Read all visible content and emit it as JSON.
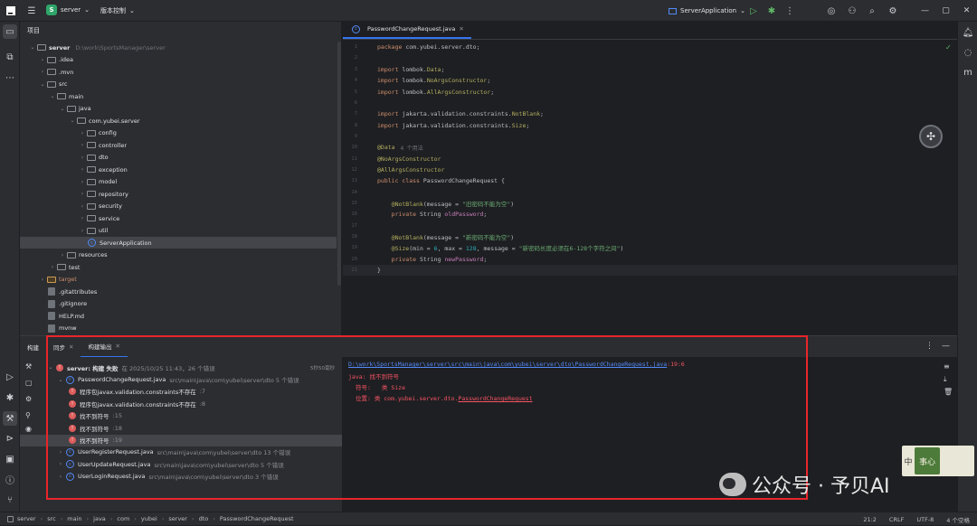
{
  "titlebar": {
    "project_badge": "S",
    "project": "server",
    "vcs": "版本控制",
    "run_config": "ServerApplication"
  },
  "project_panel": {
    "title": "项目",
    "tree": [
      {
        "label": "server",
        "hint": "D:\\work\\SportsManager\\server",
        "depth": 0,
        "kind": "module",
        "open": true
      },
      {
        "label": ".idea",
        "depth": 1,
        "kind": "folder"
      },
      {
        "label": ".mvn",
        "depth": 1,
        "kind": "folder"
      },
      {
        "label": "src",
        "depth": 1,
        "kind": "folder",
        "open": true
      },
      {
        "label": "main",
        "depth": 2,
        "kind": "folder",
        "open": true
      },
      {
        "label": "java",
        "depth": 3,
        "kind": "src",
        "open": true
      },
      {
        "label": "com.yubei.server",
        "depth": 4,
        "kind": "pkg",
        "open": true
      },
      {
        "label": "config",
        "depth": 5,
        "kind": "pkg"
      },
      {
        "label": "controller",
        "depth": 5,
        "kind": "pkg"
      },
      {
        "label": "dto",
        "depth": 5,
        "kind": "pkg"
      },
      {
        "label": "exception",
        "depth": 5,
        "kind": "pkg"
      },
      {
        "label": "model",
        "depth": 5,
        "kind": "pkg"
      },
      {
        "label": "repository",
        "depth": 5,
        "kind": "pkg"
      },
      {
        "label": "security",
        "depth": 5,
        "kind": "pkg"
      },
      {
        "label": "service",
        "depth": 5,
        "kind": "pkg"
      },
      {
        "label": "util",
        "depth": 5,
        "kind": "pkg"
      },
      {
        "label": "ServerApplication",
        "depth": 5,
        "kind": "class",
        "selected": true
      },
      {
        "label": "resources",
        "depth": 3,
        "kind": "folder"
      },
      {
        "label": "test",
        "depth": 2,
        "kind": "folder"
      },
      {
        "label": "target",
        "depth": 1,
        "kind": "target"
      },
      {
        "label": ".gitattributes",
        "depth": 1,
        "kind": "file"
      },
      {
        "label": ".gitignore",
        "depth": 1,
        "kind": "file"
      },
      {
        "label": "HELP.md",
        "depth": 1,
        "kind": "file"
      },
      {
        "label": "mvnw",
        "depth": 1,
        "kind": "file"
      }
    ]
  },
  "editor": {
    "tab": "PasswordChangeRequest.java",
    "lines": [
      {
        "n": "1",
        "tokens": [
          [
            "kw",
            "package "
          ],
          [
            "cls",
            "com.yubei.server.dto;"
          ]
        ]
      },
      {
        "n": "2",
        "tokens": []
      },
      {
        "n": "3",
        "tokens": [
          [
            "kw",
            "import "
          ],
          [
            "cls",
            "lombok."
          ],
          [
            "ann",
            "Data"
          ],
          [
            "cls",
            ";"
          ]
        ]
      },
      {
        "n": "4",
        "tokens": [
          [
            "kw",
            "import "
          ],
          [
            "cls",
            "lombok."
          ],
          [
            "ann",
            "NoArgsConstructor"
          ],
          [
            "cls",
            ";"
          ]
        ]
      },
      {
        "n": "5",
        "tokens": [
          [
            "kw",
            "import "
          ],
          [
            "cls",
            "lombok."
          ],
          [
            "ann",
            "AllArgsConstructor"
          ],
          [
            "cls",
            ";"
          ]
        ]
      },
      {
        "n": "6",
        "tokens": []
      },
      {
        "n": "7",
        "tokens": [
          [
            "kw",
            "import "
          ],
          [
            "cls",
            "jakarta.validation.constraints."
          ],
          [
            "ann",
            "NotBlank"
          ],
          [
            "cls",
            ";"
          ]
        ]
      },
      {
        "n": "8",
        "tokens": [
          [
            "kw",
            "import "
          ],
          [
            "cls",
            "jakarta.validation.constraints."
          ],
          [
            "ann",
            "Size"
          ],
          [
            "cls",
            ";"
          ]
        ]
      },
      {
        "n": "9",
        "tokens": []
      },
      {
        "n": "10",
        "tokens": [
          [
            "ann",
            "@Data"
          ]
        ],
        "hint": "4 个用法"
      },
      {
        "n": "11",
        "tokens": [
          [
            "ann",
            "@NoArgsConstructor"
          ]
        ]
      },
      {
        "n": "12",
        "tokens": [
          [
            "ann",
            "@AllArgsConstructor"
          ]
        ]
      },
      {
        "n": "13",
        "tokens": [
          [
            "kw",
            "public class "
          ],
          [
            "cls",
            "PasswordChangeRequest {"
          ]
        ]
      },
      {
        "n": "14",
        "tokens": []
      },
      {
        "n": "15",
        "tokens": [
          [
            "cls",
            "    "
          ],
          [
            "ann",
            "@NotBlank"
          ],
          [
            "cls",
            "(message = "
          ],
          [
            "str",
            "\"旧密码不能为空\""
          ],
          [
            "cls",
            ")"
          ]
        ]
      },
      {
        "n": "16",
        "tokens": [
          [
            "cls",
            "    "
          ],
          [
            "kw",
            "private "
          ],
          [
            "cls",
            "String "
          ],
          [
            "fld",
            "oldPassword"
          ],
          [
            "cls",
            ";"
          ]
        ]
      },
      {
        "n": "17",
        "tokens": []
      },
      {
        "n": "18",
        "tokens": [
          [
            "cls",
            "    "
          ],
          [
            "ann",
            "@NotBlank"
          ],
          [
            "cls",
            "(message = "
          ],
          [
            "str",
            "\"新密码不能为空\""
          ],
          [
            "cls",
            ")"
          ]
        ]
      },
      {
        "n": "19",
        "tokens": [
          [
            "cls",
            "    "
          ],
          [
            "ann",
            "@Size"
          ],
          [
            "cls",
            "(min = "
          ],
          [
            "num",
            "6"
          ],
          [
            "cls",
            ", max = "
          ],
          [
            "num",
            "128"
          ],
          [
            "cls",
            ", message = "
          ],
          [
            "str",
            "\"新密码长度必须在6-128个字符之间\""
          ],
          [
            "cls",
            ")"
          ]
        ]
      },
      {
        "n": "20",
        "tokens": [
          [
            "cls",
            "    "
          ],
          [
            "kw",
            "private "
          ],
          [
            "cls",
            "String "
          ],
          [
            "fld",
            "newPassword"
          ],
          [
            "cls",
            ";"
          ]
        ]
      },
      {
        "n": "21",
        "tokens": [
          [
            "cls",
            "}"
          ]
        ],
        "current": true
      }
    ]
  },
  "build_panel": {
    "title": "构建",
    "tabs": [
      "同步",
      "构建输出"
    ],
    "summary": "server: 构建 失败",
    "summary_time": "在 2025/10/25 11:43，26 个错误",
    "duration": "5秒50毫秒",
    "tree": [
      {
        "label": "PasswordChangeRequest.java",
        "hint": "src\\main\\java\\com\\yubei\\server\\dto 5 个错误",
        "depth": 1,
        "kind": "file",
        "open": true
      },
      {
        "label": "程序包javax.validation.constraints不存在",
        "hint": ":7",
        "depth": 2,
        "kind": "err"
      },
      {
        "label": "程序包javax.validation.constraints不存在",
        "hint": ":8",
        "depth": 2,
        "kind": "err"
      },
      {
        "label": "找不到符号",
        "hint": ":15",
        "depth": 2,
        "kind": "err"
      },
      {
        "label": "找不到符号",
        "hint": ":18",
        "depth": 2,
        "kind": "err"
      },
      {
        "label": "找不到符号",
        "hint": ":19",
        "depth": 2,
        "kind": "err",
        "selected": true
      },
      {
        "label": "UserRegisterRequest.java",
        "hint": "src\\main\\java\\com\\yubei\\server\\dto 13 个错误",
        "depth": 1,
        "kind": "file"
      },
      {
        "label": "UserUpdateRequest.java",
        "hint": "src\\main\\java\\com\\yubei\\server\\dto 5 个错误",
        "depth": 1,
        "kind": "file"
      },
      {
        "label": "UserLoginRequest.java",
        "hint": "src\\main\\java\\com\\yubei\\server\\dto 3 个错误",
        "depth": 1,
        "kind": "file"
      }
    ],
    "output": {
      "path": "D:\\work\\SportsManager\\server\\src\\main\\java\\com\\yubei\\server\\dto\\PasswordChangeRequest.java",
      "pos": ":19:6",
      "error": "java: 找不到符号",
      "symbol_label": "符号:",
      "symbol_value": "类 Size",
      "location_label": "位置: 类 com.yubei.server.dto.",
      "location_link": "PasswordChangeRequest"
    }
  },
  "status_bar": {
    "crumbs": [
      "server",
      "src",
      "main",
      "java",
      "com",
      "yubei",
      "server",
      "dto",
      "PasswordChangeRequest"
    ],
    "cursor": "21:2",
    "line_sep": "CRLF",
    "encoding": "UTF-8",
    "indent": "4 个空格"
  },
  "watermark": {
    "text": "公众号 · 予贝AI",
    "seal_left": "中",
    "seal_mid": "事心"
  },
  "colors": {
    "highlight": "#e8262b",
    "accent": "#3574f0",
    "error": "#db5c5c"
  }
}
